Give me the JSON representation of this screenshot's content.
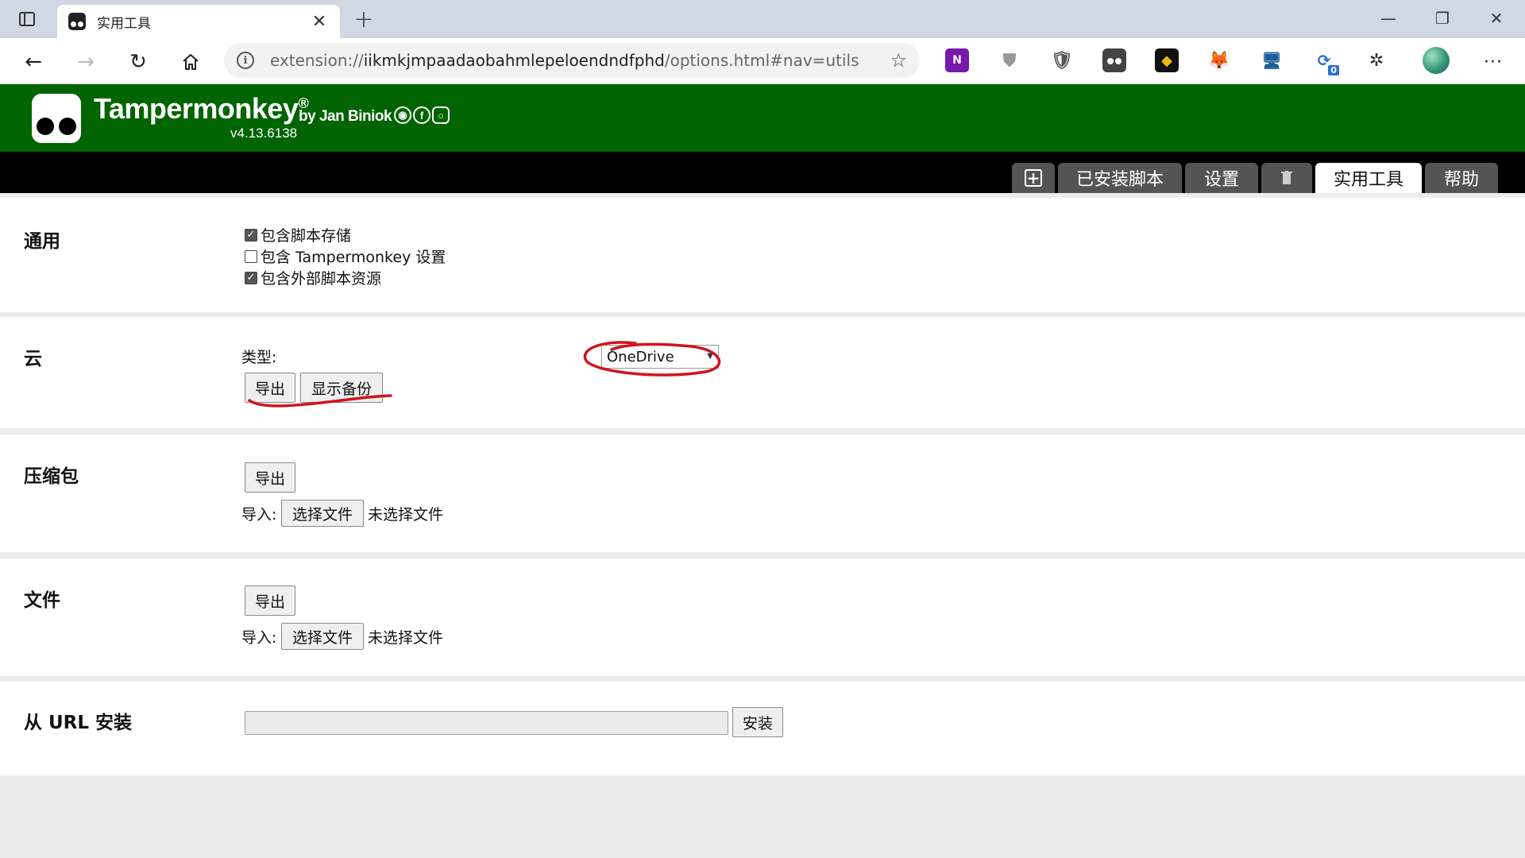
{
  "browser": {
    "tab_title": "实用工具",
    "url_scheme": "extension://",
    "url_host": "iikmkjmpaadaobahmlepeloendndfphd",
    "url_path": "/options.html#nav=utils",
    "extension_badge_count": "0"
  },
  "tm_header": {
    "title": "Tampermonkey",
    "registered_mark": "®",
    "byline": "by Jan Biniok",
    "version": "v4.13.6138",
    "brand_color": "#006400"
  },
  "nav_tabs": {
    "items": [
      {
        "label": "已安装脚本"
      },
      {
        "label": "设置"
      },
      {
        "label": "实用工具"
      },
      {
        "label": "帮助"
      }
    ]
  },
  "sections": {
    "general": {
      "title": "通用",
      "options": [
        {
          "label": "包含脚本存储",
          "checked": true
        },
        {
          "label": "包含 Tampermonkey 设置",
          "checked": false
        },
        {
          "label": "包含外部脚本资源",
          "checked": true
        }
      ]
    },
    "cloud": {
      "title": "云",
      "type_label": "类型:",
      "type_value": "OneDrive",
      "export_label": "导出",
      "show_backup_label": "显示备份"
    },
    "zip": {
      "title": "压缩包",
      "export_label": "导出",
      "import_label": "导入:",
      "choose_file_label": "选择文件",
      "no_file_label": "未选择文件"
    },
    "file": {
      "title": "文件",
      "export_label": "导出",
      "import_label": "导入:",
      "choose_file_label": "选择文件",
      "no_file_label": "未选择文件"
    },
    "url_install": {
      "title": "从 URL 安装",
      "input_value": "",
      "install_label": "安装"
    }
  },
  "annotation_color": "#d0141f"
}
